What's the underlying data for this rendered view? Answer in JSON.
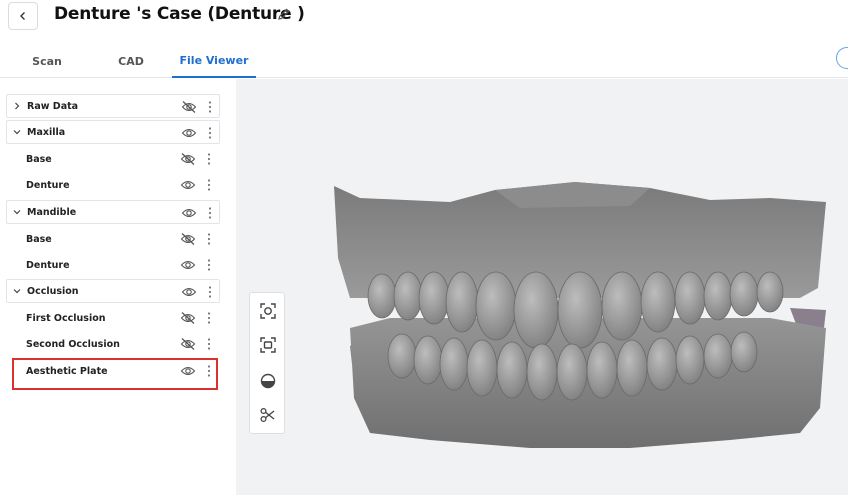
{
  "header": {
    "title": "Denture 's Case (Denture )"
  },
  "tabs": [
    {
      "label": "Scan",
      "active": false
    },
    {
      "label": "CAD",
      "active": false
    },
    {
      "label": "File Viewer",
      "active": true
    }
  ],
  "tree": [
    {
      "label": "Raw Data",
      "type": "group",
      "expanded": false,
      "visible": false
    },
    {
      "label": "Maxilla",
      "type": "group",
      "expanded": true,
      "visible": true
    },
    {
      "label": "Base",
      "type": "child",
      "visible": false
    },
    {
      "label": "Denture",
      "type": "child",
      "visible": true
    },
    {
      "label": "Mandible",
      "type": "group",
      "expanded": true,
      "visible": true
    },
    {
      "label": "Base",
      "type": "child",
      "visible": false
    },
    {
      "label": "Denture",
      "type": "child",
      "visible": true
    },
    {
      "label": "Occlusion",
      "type": "group",
      "expanded": true,
      "visible": true
    },
    {
      "label": "First Occlusion",
      "type": "child",
      "visible": false
    },
    {
      "label": "Second Occlusion",
      "type": "child",
      "visible": false
    },
    {
      "label": "Aesthetic Plate",
      "type": "child",
      "visible": true,
      "highlighted": true
    }
  ],
  "toolbox": {
    "tools": [
      "focus-view-icon",
      "fit-view-icon",
      "clip-plane-icon",
      "scissors-icon"
    ]
  },
  "colors": {
    "accent": "#1f6fd1",
    "highlight": "#d9312b",
    "model_gray": "#8a8a8a",
    "viewport_bg": "#f1f2f4"
  }
}
